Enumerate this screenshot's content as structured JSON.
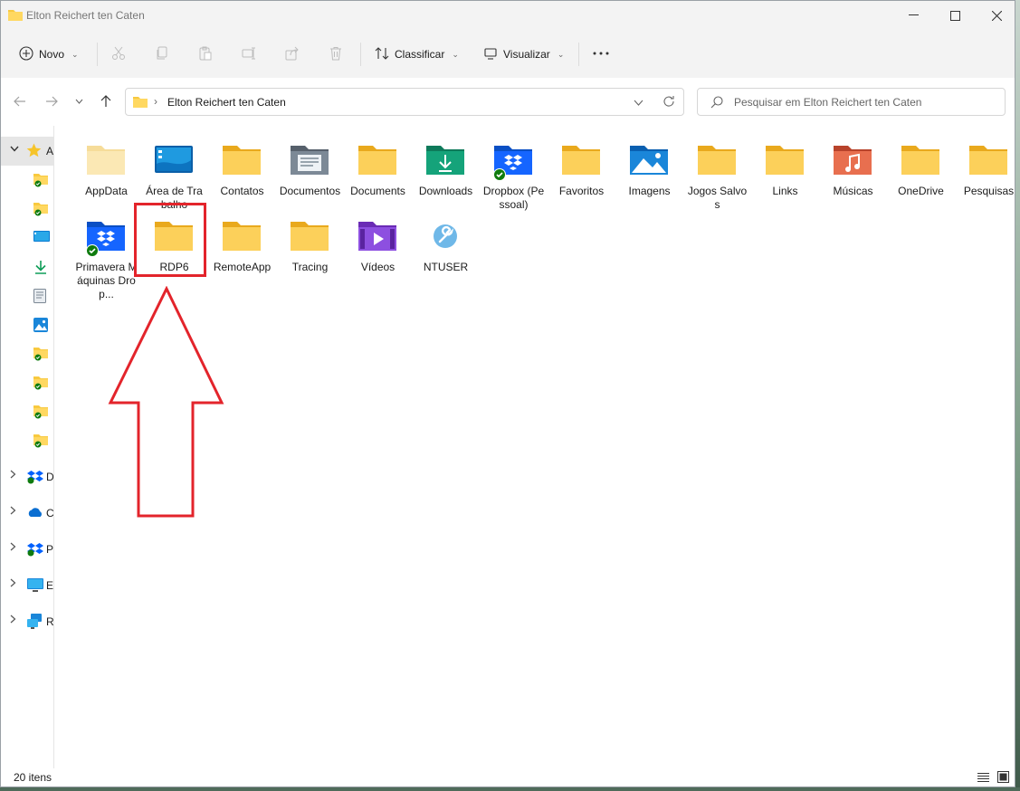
{
  "window": {
    "title": "Elton Reichert ten Caten"
  },
  "toolbar": {
    "new_label": "Novo",
    "sort_label": "Classificar",
    "view_label": "Visualizar"
  },
  "address": {
    "path": "Elton Reichert ten Caten"
  },
  "search": {
    "placeholder": "Pesquisar em Elton Reichert ten Caten"
  },
  "sidebar": {
    "quick_access_label": "A",
    "groups": [
      {
        "label": "D",
        "icon": "dropbox-icon"
      },
      {
        "label": "C",
        "icon": "onedrive-icon"
      },
      {
        "label": "P",
        "icon": "dropbox-icon"
      },
      {
        "label": "E",
        "icon": "this-pc-icon"
      },
      {
        "label": "R",
        "icon": "network-icon"
      }
    ]
  },
  "files": [
    {
      "name": "AppData",
      "icon": "folder-light-icon"
    },
    {
      "name": "Área de Trabalho",
      "icon": "desktop-icon"
    },
    {
      "name": "Contatos",
      "icon": "folder-icon"
    },
    {
      "name": "Documentos",
      "icon": "documents-icon"
    },
    {
      "name": "Documents",
      "icon": "folder-icon"
    },
    {
      "name": "Downloads",
      "icon": "downloads-icon"
    },
    {
      "name": "Dropbox (Pessoal)",
      "icon": "dropbox-icon"
    },
    {
      "name": "Favoritos",
      "icon": "folder-icon"
    },
    {
      "name": "Imagens",
      "icon": "pictures-icon"
    },
    {
      "name": "Jogos Salvos",
      "icon": "folder-icon"
    },
    {
      "name": "Links",
      "icon": "folder-icon"
    },
    {
      "name": "Músicas",
      "icon": "music-icon"
    },
    {
      "name": "OneDrive",
      "icon": "folder-icon"
    },
    {
      "name": "Pesquisas",
      "icon": "folder-icon"
    },
    {
      "name": "Primavera Máquinas Drop...",
      "icon": "dropbox-icon"
    },
    {
      "name": "RDP6",
      "icon": "folder-icon"
    },
    {
      "name": "RemoteApp",
      "icon": "folder-icon"
    },
    {
      "name": "Tracing",
      "icon": "folder-icon"
    },
    {
      "name": "Vídeos",
      "icon": "videos-icon"
    },
    {
      "name": "NTUSER",
      "icon": "settings-file-icon"
    }
  ],
  "status": {
    "item_count": "20 itens"
  },
  "colors": {
    "accent": "#0067c0",
    "folder": "#f8c93f",
    "annotation": "#e3242b"
  }
}
